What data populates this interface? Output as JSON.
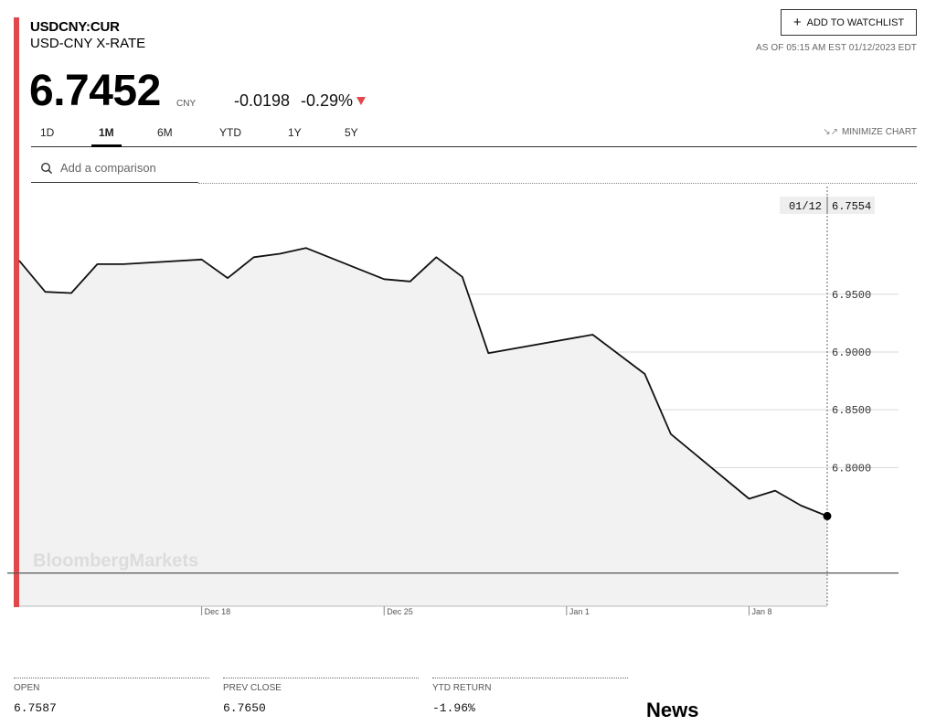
{
  "ticker": "USDCNY:CUR",
  "name": "USD-CNY X-RATE",
  "watchlist_label": "ADD TO WATCHLIST",
  "as_of": "AS OF 05:15 AM EST 01/12/2023 EDT",
  "price": "6.7452",
  "currency": "CNY",
  "change": "-0.0198",
  "change_pct": "-0.29%",
  "colors": {
    "accent": "#e0484b",
    "line": "#111111",
    "fill": "#f2f2f2"
  },
  "range_tabs": [
    {
      "label": "1D",
      "active": false
    },
    {
      "label": "1M",
      "active": true
    },
    {
      "label": "6M",
      "active": false
    },
    {
      "label": "YTD",
      "active": false
    },
    {
      "label": "1Y",
      "active": false
    },
    {
      "label": "5Y",
      "active": false
    }
  ],
  "minimize_label": "MINIMIZE CHART",
  "compare_placeholder": "Add a comparison",
  "watermark": "BloombergMarkets",
  "chart_data": {
    "type": "area",
    "xlabel": "",
    "ylabel": "",
    "x_ticks": [
      "Dec 18",
      "Dec 25",
      "Jan 1",
      "Jan 8"
    ],
    "x_tick_days": [
      7,
      14,
      21,
      28
    ],
    "y_ticks": [
      6.8,
      6.85,
      6.9,
      6.95
    ],
    "y_tick_labels": [
      "6.8000",
      "6.8500",
      "6.9000",
      "6.9500"
    ],
    "ylim": [
      6.68,
      7.04
    ],
    "xlim": [
      0,
      31.5
    ],
    "baseline": 6.7087,
    "grid": true,
    "hover": {
      "date": "01/12",
      "value": "6.7554"
    },
    "series": [
      {
        "x": [
          0,
          1,
          2,
          3,
          4,
          7,
          8,
          9,
          10,
          11,
          14,
          15,
          16,
          17,
          18,
          22,
          24,
          25,
          28,
          29,
          30,
          31
        ],
        "values": [
          6.979,
          6.952,
          6.951,
          6.976,
          6.976,
          6.98,
          6.964,
          6.982,
          6.985,
          6.99,
          6.963,
          6.961,
          6.982,
          6.965,
          6.899,
          6.915,
          6.881,
          6.829,
          6.773,
          6.78,
          6.767,
          6.758
        ]
      }
    ]
  },
  "stats": [
    {
      "label": "OPEN",
      "value": "6.7587"
    },
    {
      "label": "PREV CLOSE",
      "value": "6.7650"
    },
    {
      "label": "YTD RETURN",
      "value": "-1.96%"
    }
  ],
  "news_heading": "News"
}
